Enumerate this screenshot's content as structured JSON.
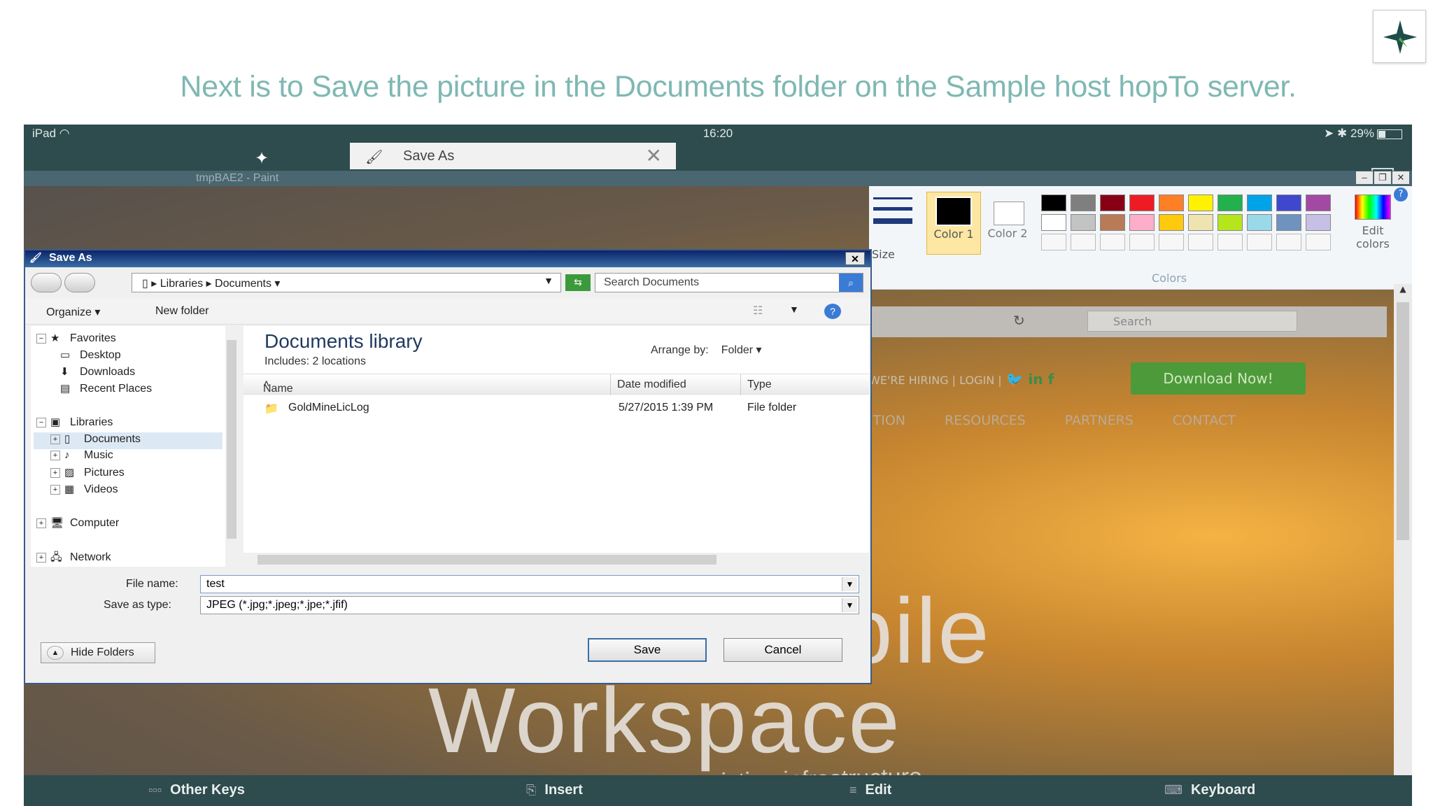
{
  "caption": "Next is to Save the picture in the Documents folder on the Sample host hopTo server.",
  "logo": {
    "icon": "hopto-star-icon",
    "color": "#1f4d4a"
  },
  "status_bar": {
    "device": "iPad",
    "time": "16:20",
    "battery": "29%"
  },
  "tabs": {
    "active_tab": "Save As"
  },
  "paint_window": {
    "title": "tmpBAE2 - Paint"
  },
  "ribbon": {
    "size_label": "Size",
    "color1_label": "Color 1",
    "color2_label": "Color 2",
    "colors_group_label": "Colors",
    "edit_colors_label": "Edit colors",
    "palette_row1": [
      "#000000",
      "#7f7f7f",
      "#880015",
      "#ed1c24",
      "#ff7f27",
      "#fff200",
      "#22b14c",
      "#00a2e8",
      "#3f48cc",
      "#a349a4"
    ],
    "palette_row2": [
      "#ffffff",
      "#c3c3c3",
      "#b97a57",
      "#ffaec9",
      "#ffc90e",
      "#efe4b0",
      "#b5e61d",
      "#99d9ea",
      "#7092be",
      "#c8bfe7"
    ]
  },
  "website": {
    "search_placeholder": "Search",
    "top_links": "WE'RE HIRING | LOGIN |",
    "download_button": "Download Now!",
    "nav": [
      "ITION",
      "RESOURCES",
      "PARTNERS",
      "CONTACT"
    ],
    "headline_line1": "The New Mobile",
    "headline_line2": "Workspace",
    "tagline": "Instantly mobilize your workforce using your existing infrastructure."
  },
  "dialog": {
    "title": "Save As",
    "address": {
      "part1": "Libraries",
      "part2": "Documents"
    },
    "search_placeholder": "Search Documents",
    "toolbar": {
      "organize": "Organize",
      "new_folder": "New folder"
    },
    "nav": {
      "favorites": "Favorites",
      "desktop": "Desktop",
      "downloads": "Downloads",
      "recent_places": "Recent Places",
      "libraries": "Libraries",
      "documents": "Documents",
      "music": "Music",
      "pictures": "Pictures",
      "videos": "Videos",
      "computer": "Computer",
      "network": "Network"
    },
    "library": {
      "title": "Documents library",
      "includes": "Includes:  2 locations",
      "arrange_label": "Arrange by:",
      "arrange_value": "Folder"
    },
    "columns": {
      "name": "Name",
      "date": "Date modified",
      "type": "Type"
    },
    "files": [
      {
        "name": "GoldMineLicLog",
        "date": "5/27/2015 1:39 PM",
        "type": "File folder"
      }
    ],
    "file_name_label": "File name:",
    "file_name_value": "test",
    "save_type_label": "Save as type:",
    "save_type_value": "JPEG (*.jpg;*.jpeg;*.jpe;*.jfif)",
    "hide_folders": "Hide Folders",
    "save_button": "Save",
    "cancel_button": "Cancel"
  },
  "keybar": {
    "other_keys": "Other Keys",
    "insert": "Insert",
    "edit": "Edit",
    "keyboard": "Keyboard"
  }
}
